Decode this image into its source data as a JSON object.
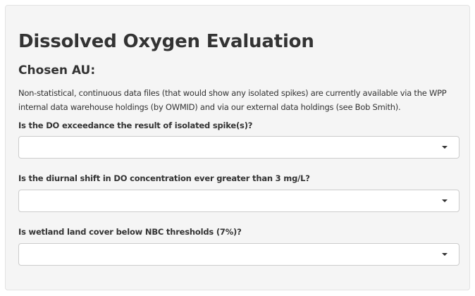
{
  "page": {
    "title": "Dissolved Oxygen Evaluation",
    "au_heading": "Chosen AU:",
    "note": "Non-statistical, continuous data files (that would show any isolated spikes) are currently available via the WPP internal data warehouse holdings (by OWMID) and via our external data holdings (see Bob Smith)."
  },
  "questions": [
    {
      "label": "Is the DO exceedance the result of isolated spike(s)?",
      "selected": "",
      "icon": "caret-down-icon"
    },
    {
      "label": "Is the diurnal shift in DO concentration ever greater than 3 mg/L?",
      "selected": "",
      "icon": "caret-down-icon"
    },
    {
      "label": "Is wetland land cover below NBC thresholds (7%)?",
      "selected": "",
      "icon": "caret-down-icon"
    }
  ],
  "colors": {
    "panel_background": "#f5f5f5",
    "panel_border": "#e3e3e3",
    "text": "#333333",
    "input_border": "#cccccc"
  }
}
